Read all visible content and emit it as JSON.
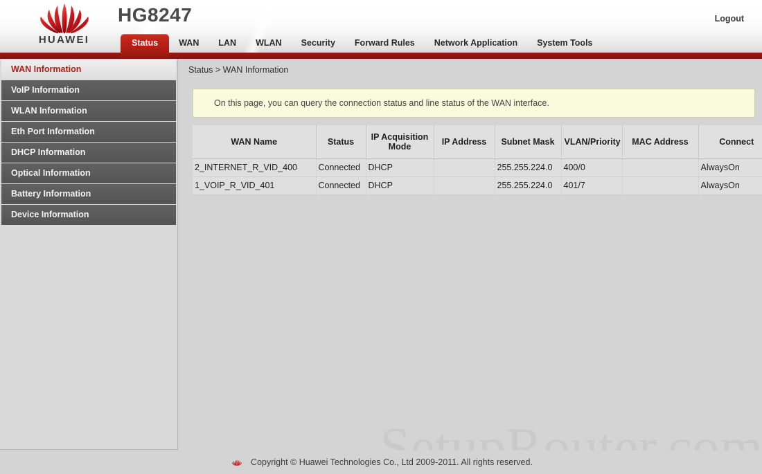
{
  "header": {
    "brand": "HUAWEI",
    "model": "HG8247",
    "logout_label": "Logout"
  },
  "nav": {
    "items": [
      {
        "label": "Status",
        "active": true
      },
      {
        "label": "WAN",
        "active": false
      },
      {
        "label": "LAN",
        "active": false
      },
      {
        "label": "WLAN",
        "active": false
      },
      {
        "label": "Security",
        "active": false
      },
      {
        "label": "Forward Rules",
        "active": false
      },
      {
        "label": "Network Application",
        "active": false
      },
      {
        "label": "System Tools",
        "active": false
      }
    ]
  },
  "sidebar": {
    "items": [
      {
        "label": "WAN Information",
        "active": true
      },
      {
        "label": "VoIP Information",
        "active": false
      },
      {
        "label": "WLAN Information",
        "active": false
      },
      {
        "label": "Eth Port Information",
        "active": false
      },
      {
        "label": "DHCP Information",
        "active": false
      },
      {
        "label": "Optical Information",
        "active": false
      },
      {
        "label": "Battery Information",
        "active": false
      },
      {
        "label": "Device Information",
        "active": false
      }
    ]
  },
  "content": {
    "breadcrumb": "Status > WAN Information",
    "notice": "On this page, you can query the connection status and line status of the WAN interface.",
    "watermark": "SetupRouter.com",
    "table": {
      "columns": [
        "WAN Name",
        "Status",
        "IP Acquisition Mode",
        "IP Address",
        "Subnet Mask",
        "VLAN/Priority",
        "MAC Address",
        "Connect"
      ],
      "rows": [
        {
          "wan_name": "2_INTERNET_R_VID_400",
          "status": "Connected",
          "ip_acquisition_mode": "DHCP",
          "ip_address": "",
          "subnet_mask": "255.255.224.0",
          "vlan_priority": "400/0",
          "mac_address": "",
          "connect": "AlwaysOn"
        },
        {
          "wan_name": "1_VOIP_R_VID_401",
          "status": "Connected",
          "ip_acquisition_mode": "DHCP",
          "ip_address": "",
          "subnet_mask": "255.255.224.0",
          "vlan_priority": "401/7",
          "mac_address": "",
          "connect": "AlwaysOn"
        }
      ]
    }
  },
  "footer": {
    "copyright": "Copyright © Huawei Technologies Co., Ltd 2009-2011. All rights reserved."
  },
  "colors": {
    "brand_red": "#b02018",
    "nav_bar_red": "#8d1710",
    "active_tab_red": "#bb2117",
    "sidebar_item_gray": "#5b5b5b",
    "page_gray": "#d4d4d4",
    "notice_yellow": "#fafbdd",
    "watermark_gray": "#cacaca"
  }
}
